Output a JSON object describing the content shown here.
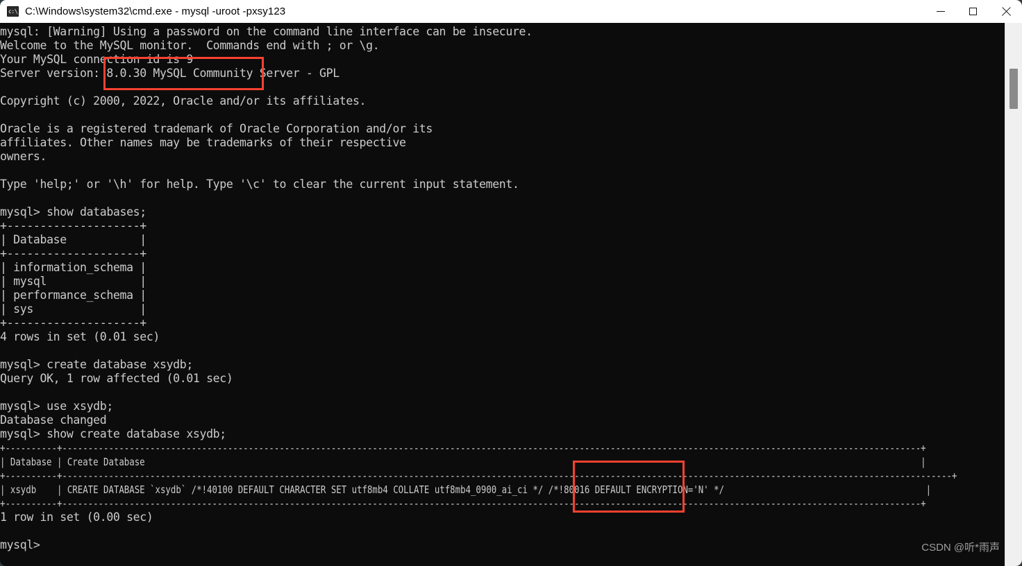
{
  "window": {
    "title": "C:\\Windows\\system32\\cmd.exe - mysql  -uroot -pxsy123",
    "icon": "cmd-icon",
    "controls": {
      "minimize": "minimize-icon",
      "maximize": "maximize-icon",
      "close": "close-icon"
    }
  },
  "terminal": {
    "lines": [
      "mysql: [Warning] Using a password on the command line interface can be insecure.",
      "Welcome to the MySQL monitor.  Commands end with ; or \\g.",
      "Your MySQL connection id is 9",
      "Server version: 8.0.30 MySQL Community Server - GPL",
      "",
      "Copyright (c) 2000, 2022, Oracle and/or its affiliates.",
      "",
      "Oracle is a registered trademark of Oracle Corporation and/or its",
      "affiliates. Other names may be trademarks of their respective",
      "owners.",
      "",
      "Type 'help;' or '\\h' for help. Type '\\c' to clear the current input statement.",
      "",
      "mysql> show databases;",
      "+--------------------+",
      "| Database           |",
      "+--------------------+",
      "| information_schema |",
      "| mysql              |",
      "| performance_schema |",
      "| sys                |",
      "+--------------------+",
      "4 rows in set (0.01 sec)",
      "",
      "mysql> create database xsydb;",
      "Query OK, 1 row affected (0.01 sec)",
      "",
      "mysql> use xsydb;",
      "Database changed",
      "mysql> show create database xsydb;"
    ],
    "wide_lines": [
      "+----------+----------------------------------------------------------------------------------------------------------------------------------------------------------------------+",
      "| Database | Create Database                                                                                                                                                      |",
      "+----------+----------------------------------------------------------------------------------------------------------------------------------------------------------------------------+",
      "| xsydb    | CREATE DATABASE `xsydb` /*!40100 DEFAULT CHARACTER SET utf8mb4 COLLATE utf8mb4_0900_ai_ci */ /*!80016 DEFAULT ENCRYPTION='N' */                                       |",
      "+----------+----------------------------------------------------------------------------------------------------------------------------------------------------------------------+"
    ],
    "tail_lines": [
      "1 row in set (0.00 sec)",
      "",
      "mysql>"
    ],
    "colors": {
      "background": "#0c0c0c",
      "foreground": "#cccccc",
      "annotation": "#f9422f"
    }
  },
  "annotations": [
    {
      "name": "server-version-highlight",
      "text": "8.0.30 MySQL Community"
    },
    {
      "name": "collation-highlight",
      "text": "utf8mb4_0900_ai_ci"
    }
  ],
  "scrollbar": {
    "name": "vertical-scrollbar"
  },
  "watermark": {
    "text": "CSDN @听*雨声"
  }
}
